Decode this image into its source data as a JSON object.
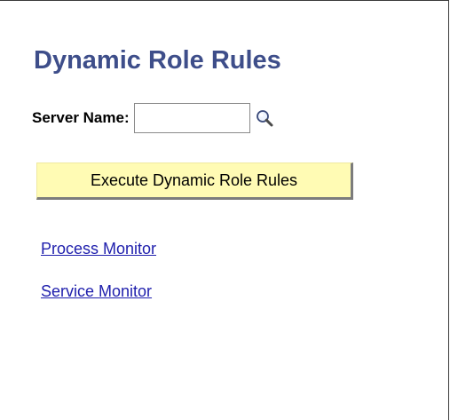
{
  "page": {
    "title": "Dynamic Role Rules"
  },
  "server": {
    "label": "Server Name:",
    "value": "",
    "placeholder": ""
  },
  "actions": {
    "execute_label": "Execute Dynamic Role Rules"
  },
  "links": [
    {
      "label": "Process Monitor"
    },
    {
      "label": "Service Monitor"
    }
  ],
  "icons": {
    "lookup": "search-icon"
  },
  "colors": {
    "title": "#3e4e8a",
    "button_bg": "#fffbb4",
    "link": "#2020ad"
  }
}
